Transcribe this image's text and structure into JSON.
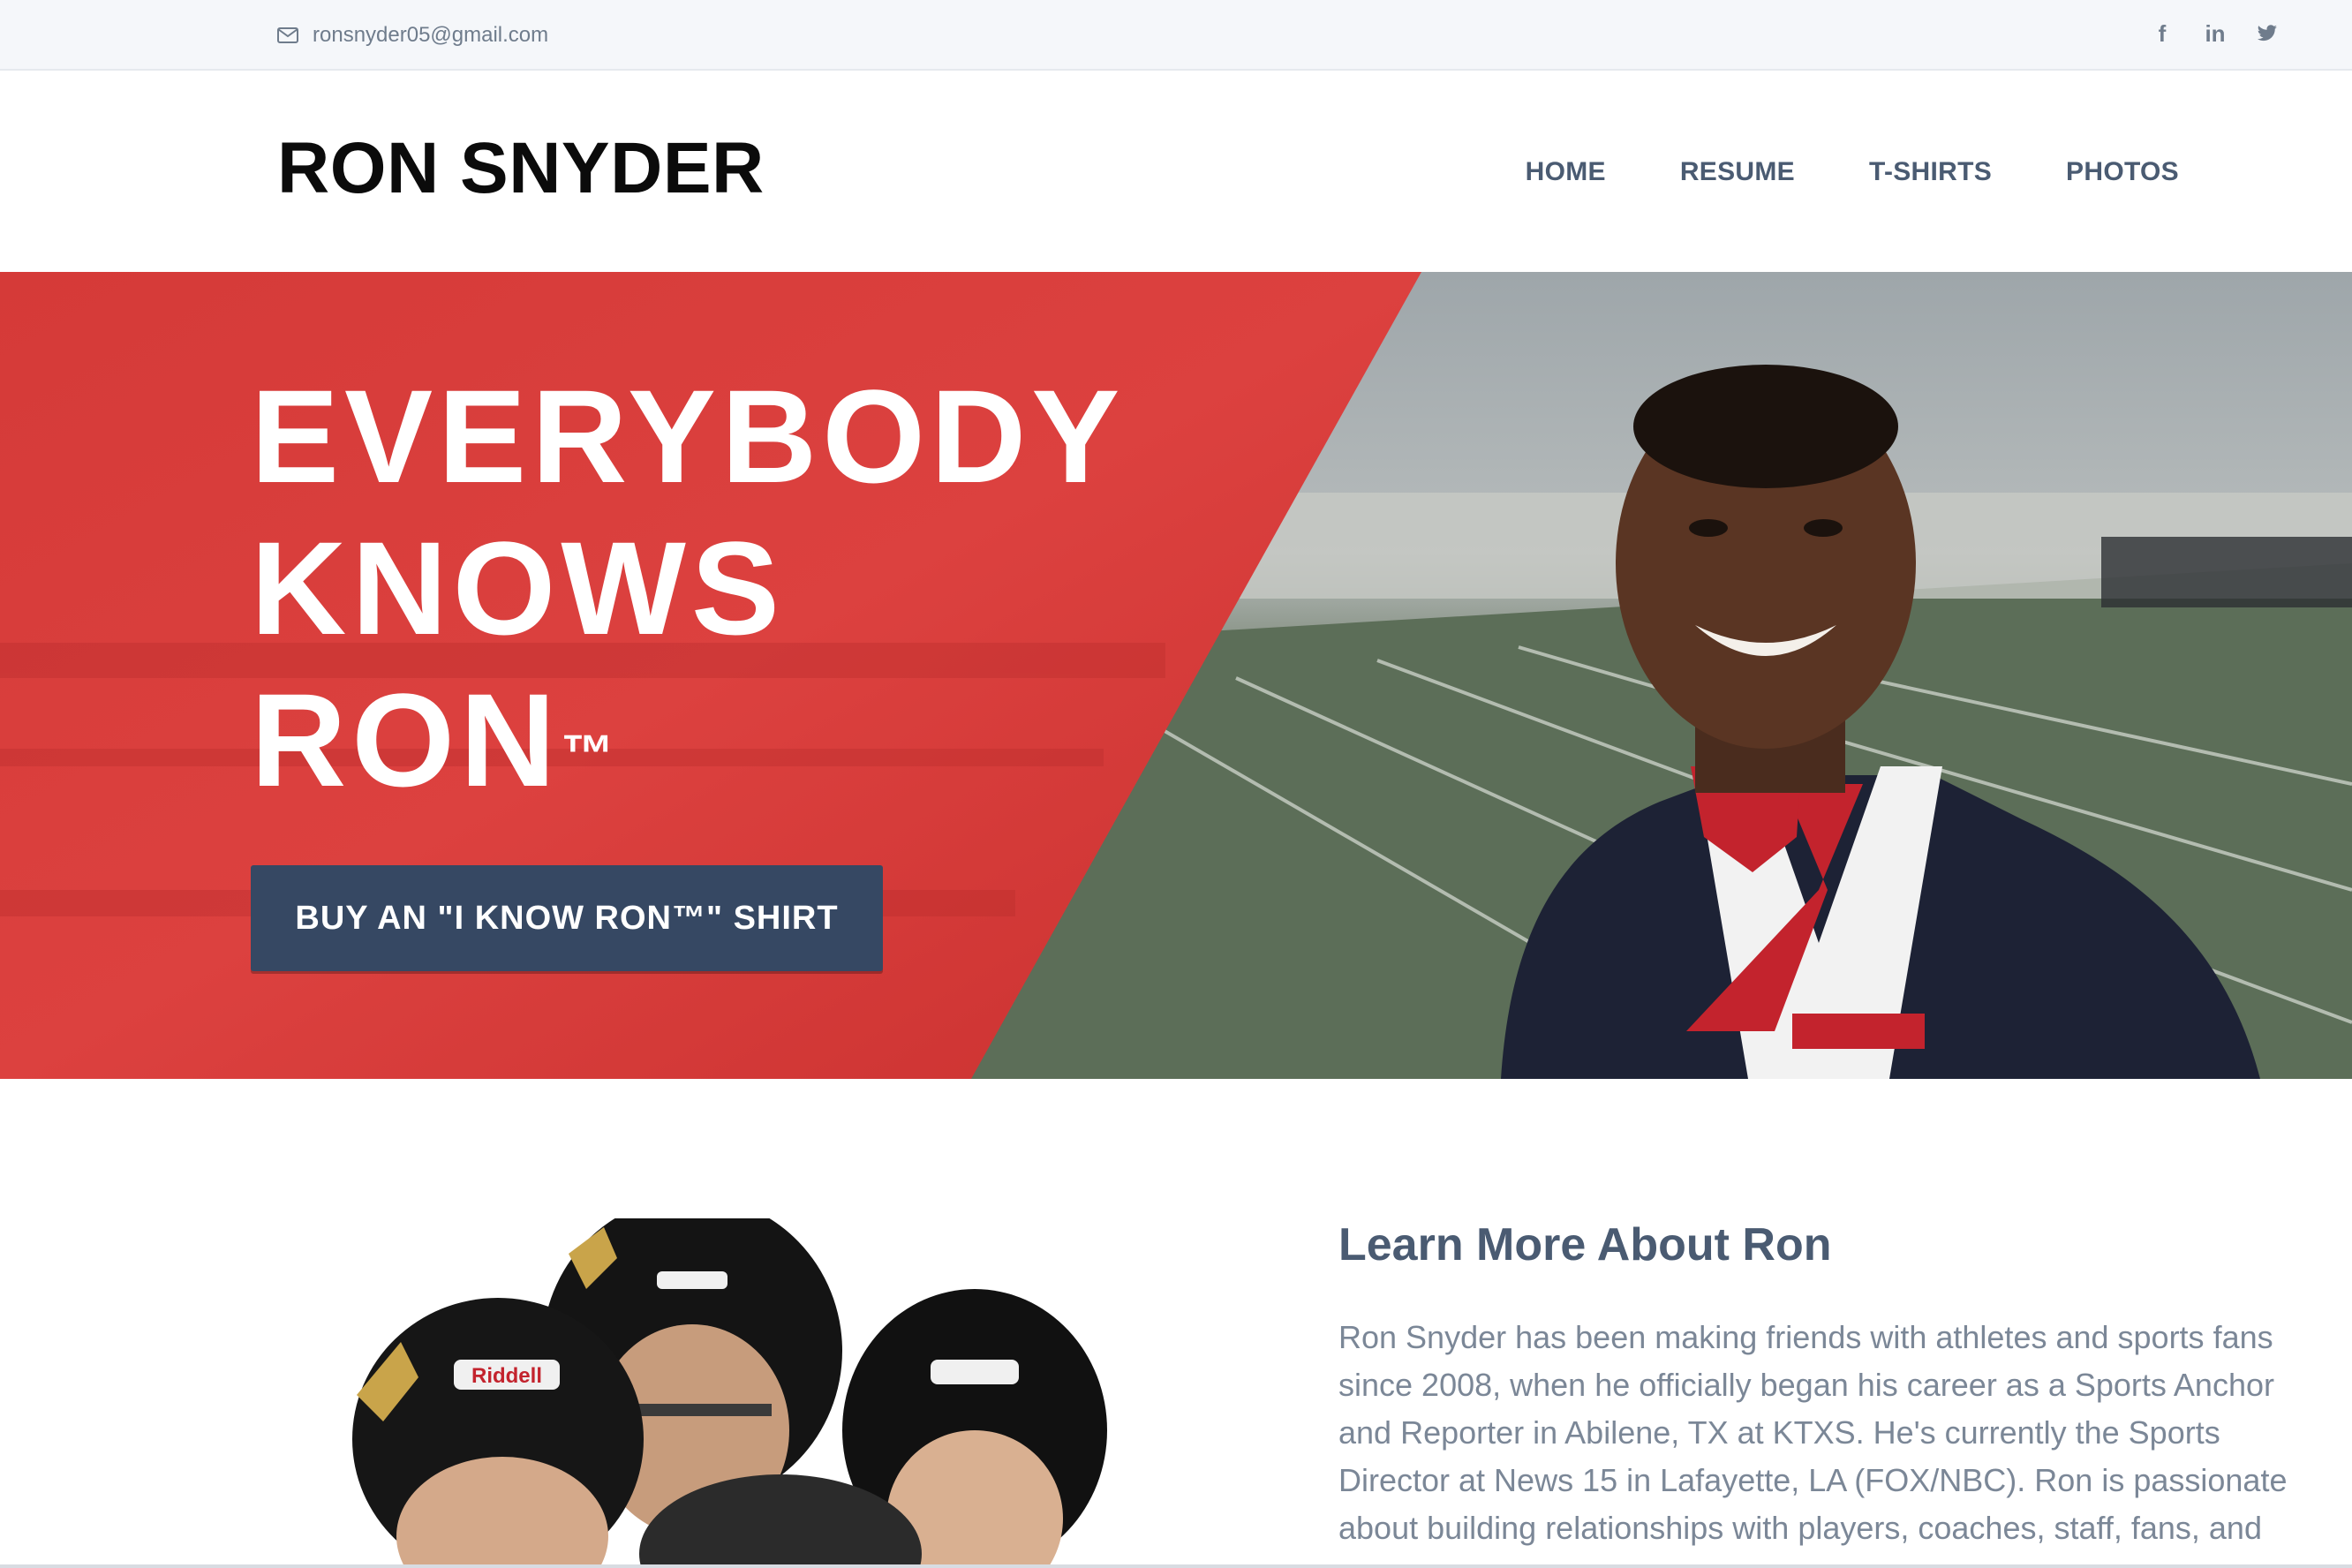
{
  "topbar": {
    "email": "ronsnyder05@gmail.com",
    "email_icon": "envelope-icon",
    "social": [
      {
        "icon": "facebook-icon",
        "glyph": "f"
      },
      {
        "icon": "linkedin-icon",
        "glyph": "in"
      },
      {
        "icon": "twitter-icon",
        "glyph": ""
      }
    ]
  },
  "header": {
    "logo": "RON SNYDER",
    "nav": [
      "HOME",
      "RESUME",
      "T-SHIRTS",
      "PHOTOS"
    ]
  },
  "hero": {
    "line1": "EVERYBODY",
    "line2": "KNOWS",
    "line3": "RON",
    "trademark": "™",
    "cta": "BUY AN \"I KNOW RON™\" SHIRT",
    "accent_color": "#d63a38",
    "button_color": "#364863"
  },
  "about": {
    "title": "Learn More About Ron",
    "text": "Ron Snyder has been making friends with athletes and sports fans since 2008, when he officially began his career as a Sports Anchor and Reporter in Abilene, TX at KTXS. He's currently the Sports Director at News 15 in Lafayette, LA (FOX/NBC). Ron is passionate about building relationships with players, coaches, staff, fans, and",
    "helmet_brand": "Riddell"
  }
}
